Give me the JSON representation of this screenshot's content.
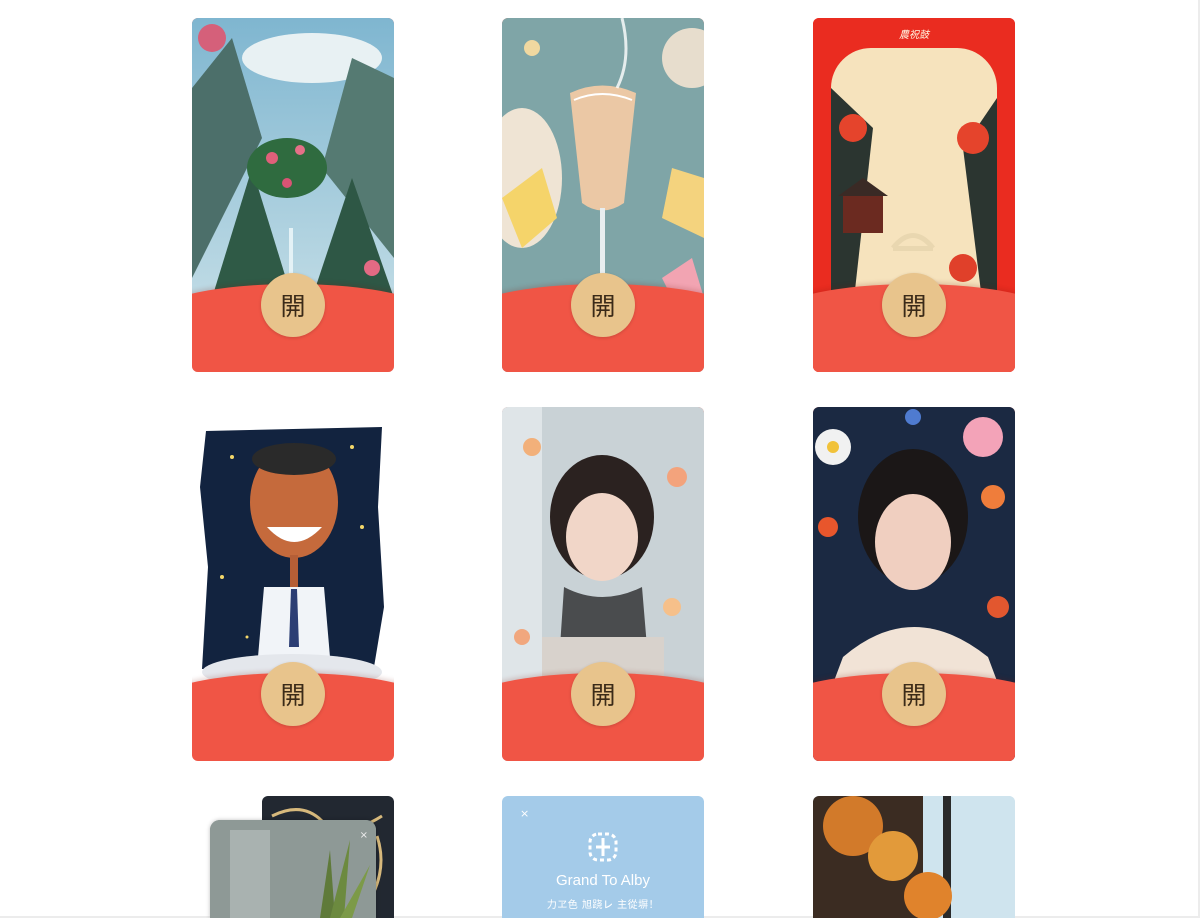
{
  "cards": [
    {
      "open_label": "開",
      "theme": "misty-mountain-landscape"
    },
    {
      "open_label": "開",
      "theme": "champagne-glass-flowers"
    },
    {
      "open_label": "開",
      "theme": "red-autumn-pavilion",
      "header_text": "農祝鼓"
    },
    {
      "open_label": "開",
      "theme": "smiling-caricature-starry-night"
    },
    {
      "open_label": "開",
      "theme": "girl-with-scarf-petals"
    },
    {
      "open_label": "開",
      "theme": "woman-flower-portrait"
    }
  ],
  "partial_cards": {
    "first": {
      "close_symbol": "×"
    },
    "second": {
      "close_symbol": "×",
      "title": "Grand To Alby",
      "subtitle": "力ヱ色 旭跷㆑ 主從塀！"
    },
    "third": {}
  },
  "colors": {
    "envelope_red": "#f05545",
    "open_button_gold": "#e8c48c"
  }
}
